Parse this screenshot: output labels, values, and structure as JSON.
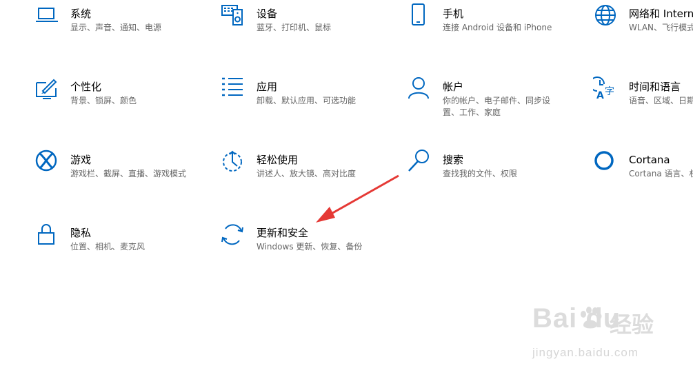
{
  "accent": "#0067c0",
  "tiles": [
    {
      "id": "system",
      "icon": "laptop-icon",
      "title": "系统",
      "desc": "显示、声音、通知、电源"
    },
    {
      "id": "devices",
      "icon": "devices-icon",
      "title": "设备",
      "desc": "蓝牙、打印机、鼠标"
    },
    {
      "id": "phone",
      "icon": "phone-icon",
      "title": "手机",
      "desc": "连接 Android 设备和 iPhone"
    },
    {
      "id": "network",
      "icon": "globe-icon",
      "title": "网络和 Internet",
      "desc": "WLAN、飞行模式、VPN"
    },
    {
      "id": "personalization",
      "icon": "paint-icon",
      "title": "个性化",
      "desc": "背景、锁屏、颜色"
    },
    {
      "id": "apps",
      "icon": "apps-list-icon",
      "title": "应用",
      "desc": "卸载、默认应用、可选功能"
    },
    {
      "id": "accounts",
      "icon": "person-icon",
      "title": "帐户",
      "desc": "你的帐户、电子邮件、同步设置、工作、家庭"
    },
    {
      "id": "time",
      "icon": "time-language-icon",
      "title": "时间和语言",
      "desc": "语音、区域、日期"
    },
    {
      "id": "gaming",
      "icon": "xbox-icon",
      "title": "游戏",
      "desc": "游戏栏、截屏、直播、游戏模式"
    },
    {
      "id": "ease",
      "icon": "ease-of-access-icon",
      "title": "轻松使用",
      "desc": "讲述人、放大镜、高对比度"
    },
    {
      "id": "search",
      "icon": "search-icon",
      "title": "搜索",
      "desc": "查找我的文件、权限"
    },
    {
      "id": "cortana",
      "icon": "cortana-icon",
      "title": "Cortana",
      "desc": "Cortana 语言、权限"
    },
    {
      "id": "privacy",
      "icon": "lock-icon",
      "title": "隐私",
      "desc": "位置、相机、麦克风"
    },
    {
      "id": "update",
      "icon": "sync-icon",
      "title": "更新和安全",
      "desc": "Windows 更新、恢复、备份"
    }
  ],
  "annotation": {
    "arrow_color": "#e53935"
  },
  "watermark": {
    "brand": "Bai du",
    "brand_cn": "经验",
    "url": "jingyan.baidu.com"
  }
}
